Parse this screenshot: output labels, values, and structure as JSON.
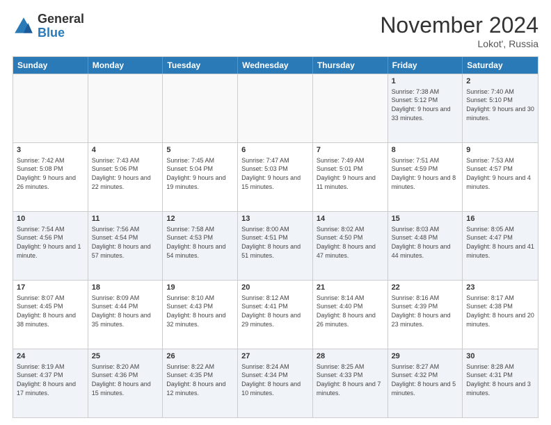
{
  "logo": {
    "general": "General",
    "blue": "Blue"
  },
  "title": "November 2024",
  "subtitle": "Lokot', Russia",
  "header_days": [
    "Sunday",
    "Monday",
    "Tuesday",
    "Wednesday",
    "Thursday",
    "Friday",
    "Saturday"
  ],
  "rows": [
    [
      {
        "day": "",
        "info": ""
      },
      {
        "day": "",
        "info": ""
      },
      {
        "day": "",
        "info": ""
      },
      {
        "day": "",
        "info": ""
      },
      {
        "day": "",
        "info": ""
      },
      {
        "day": "1",
        "info": "Sunrise: 7:38 AM\nSunset: 5:12 PM\nDaylight: 9 hours and 33 minutes."
      },
      {
        "day": "2",
        "info": "Sunrise: 7:40 AM\nSunset: 5:10 PM\nDaylight: 9 hours and 30 minutes."
      }
    ],
    [
      {
        "day": "3",
        "info": "Sunrise: 7:42 AM\nSunset: 5:08 PM\nDaylight: 9 hours and 26 minutes."
      },
      {
        "day": "4",
        "info": "Sunrise: 7:43 AM\nSunset: 5:06 PM\nDaylight: 9 hours and 22 minutes."
      },
      {
        "day": "5",
        "info": "Sunrise: 7:45 AM\nSunset: 5:04 PM\nDaylight: 9 hours and 19 minutes."
      },
      {
        "day": "6",
        "info": "Sunrise: 7:47 AM\nSunset: 5:03 PM\nDaylight: 9 hours and 15 minutes."
      },
      {
        "day": "7",
        "info": "Sunrise: 7:49 AM\nSunset: 5:01 PM\nDaylight: 9 hours and 11 minutes."
      },
      {
        "day": "8",
        "info": "Sunrise: 7:51 AM\nSunset: 4:59 PM\nDaylight: 9 hours and 8 minutes."
      },
      {
        "day": "9",
        "info": "Sunrise: 7:53 AM\nSunset: 4:57 PM\nDaylight: 9 hours and 4 minutes."
      }
    ],
    [
      {
        "day": "10",
        "info": "Sunrise: 7:54 AM\nSunset: 4:56 PM\nDaylight: 9 hours and 1 minute."
      },
      {
        "day": "11",
        "info": "Sunrise: 7:56 AM\nSunset: 4:54 PM\nDaylight: 8 hours and 57 minutes."
      },
      {
        "day": "12",
        "info": "Sunrise: 7:58 AM\nSunset: 4:53 PM\nDaylight: 8 hours and 54 minutes."
      },
      {
        "day": "13",
        "info": "Sunrise: 8:00 AM\nSunset: 4:51 PM\nDaylight: 8 hours and 51 minutes."
      },
      {
        "day": "14",
        "info": "Sunrise: 8:02 AM\nSunset: 4:50 PM\nDaylight: 8 hours and 47 minutes."
      },
      {
        "day": "15",
        "info": "Sunrise: 8:03 AM\nSunset: 4:48 PM\nDaylight: 8 hours and 44 minutes."
      },
      {
        "day": "16",
        "info": "Sunrise: 8:05 AM\nSunset: 4:47 PM\nDaylight: 8 hours and 41 minutes."
      }
    ],
    [
      {
        "day": "17",
        "info": "Sunrise: 8:07 AM\nSunset: 4:45 PM\nDaylight: 8 hours and 38 minutes."
      },
      {
        "day": "18",
        "info": "Sunrise: 8:09 AM\nSunset: 4:44 PM\nDaylight: 8 hours and 35 minutes."
      },
      {
        "day": "19",
        "info": "Sunrise: 8:10 AM\nSunset: 4:43 PM\nDaylight: 8 hours and 32 minutes."
      },
      {
        "day": "20",
        "info": "Sunrise: 8:12 AM\nSunset: 4:41 PM\nDaylight: 8 hours and 29 minutes."
      },
      {
        "day": "21",
        "info": "Sunrise: 8:14 AM\nSunset: 4:40 PM\nDaylight: 8 hours and 26 minutes."
      },
      {
        "day": "22",
        "info": "Sunrise: 8:16 AM\nSunset: 4:39 PM\nDaylight: 8 hours and 23 minutes."
      },
      {
        "day": "23",
        "info": "Sunrise: 8:17 AM\nSunset: 4:38 PM\nDaylight: 8 hours and 20 minutes."
      }
    ],
    [
      {
        "day": "24",
        "info": "Sunrise: 8:19 AM\nSunset: 4:37 PM\nDaylight: 8 hours and 17 minutes."
      },
      {
        "day": "25",
        "info": "Sunrise: 8:20 AM\nSunset: 4:36 PM\nDaylight: 8 hours and 15 minutes."
      },
      {
        "day": "26",
        "info": "Sunrise: 8:22 AM\nSunset: 4:35 PM\nDaylight: 8 hours and 12 minutes."
      },
      {
        "day": "27",
        "info": "Sunrise: 8:24 AM\nSunset: 4:34 PM\nDaylight: 8 hours and 10 minutes."
      },
      {
        "day": "28",
        "info": "Sunrise: 8:25 AM\nSunset: 4:33 PM\nDaylight: 8 hours and 7 minutes."
      },
      {
        "day": "29",
        "info": "Sunrise: 8:27 AM\nSunset: 4:32 PM\nDaylight: 8 hours and 5 minutes."
      },
      {
        "day": "30",
        "info": "Sunrise: 8:28 AM\nSunset: 4:31 PM\nDaylight: 8 hours and 3 minutes."
      }
    ]
  ]
}
